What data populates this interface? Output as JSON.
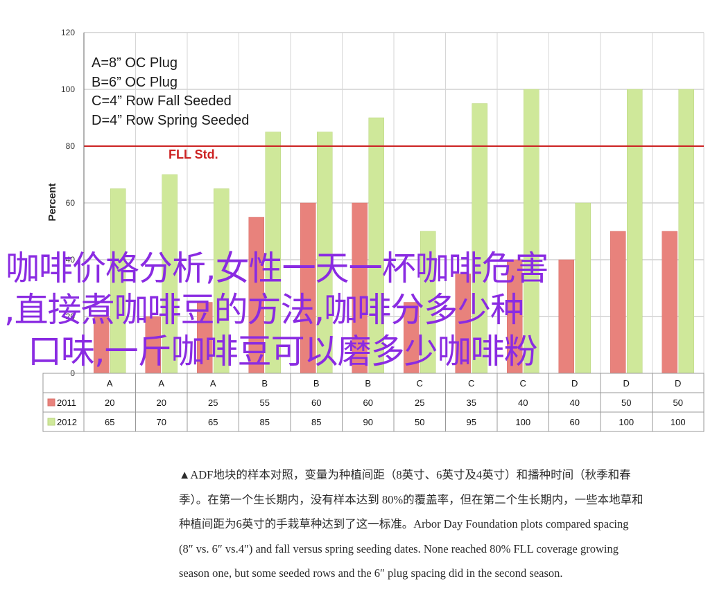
{
  "chart_data": {
    "type": "bar",
    "ylabel": "Percent",
    "ylim": [
      0,
      120
    ],
    "yticks": [
      0,
      20,
      40,
      60,
      80,
      100,
      120
    ],
    "grid": true,
    "categories": [
      "A",
      "A",
      "A",
      "B",
      "B",
      "B",
      "C",
      "C",
      "C",
      "D",
      "D",
      "D"
    ],
    "series": [
      {
        "name": "2011",
        "color": "#e8827c",
        "values": [
          20,
          20,
          25,
          55,
          60,
          60,
          25,
          35,
          40,
          40,
          50,
          50
        ]
      },
      {
        "name": "2012",
        "color": "#cfe89a",
        "values": [
          65,
          70,
          65,
          85,
          85,
          90,
          50,
          95,
          100,
          60,
          100,
          100
        ]
      }
    ],
    "reference_line": {
      "label": "FLL Std.",
      "value": 80,
      "color": "#cc2222"
    },
    "legend_text": [
      "A=8” OC Plug",
      "B=6” OC Plug",
      "C=4” Row Fall Seeded",
      "D=4” Row Spring Seeded"
    ]
  },
  "overlay_text": [
    "咖啡价格分析,女性一天一杯咖啡危害",
    ",直接煮咖啡豆的方法,咖啡分多少种",
    "口味,一斤咖啡豆可以磨多少咖啡粉"
  ],
  "caption": {
    "line1": "▲ADF地块的样本对照，变量为种植间距（8英寸、6英寸及4英寸）和播种时间（秋季和春",
    "line2": "季）。在第一个生长期内，没有样本达到 80%的覆盖率，但在第二个生长期内，一些本地草和",
    "line3": "种植间距为6英寸的手栽草种达到了这一标准。Arbor Day Foundation plots compared spacing",
    "line4": "(8″ vs. 6″ vs.4″) and fall versus spring seeding dates. None reached 80% FLL coverage growing",
    "line5": "season one, but some seeded rows and the 6″ plug spacing did in the second season."
  }
}
